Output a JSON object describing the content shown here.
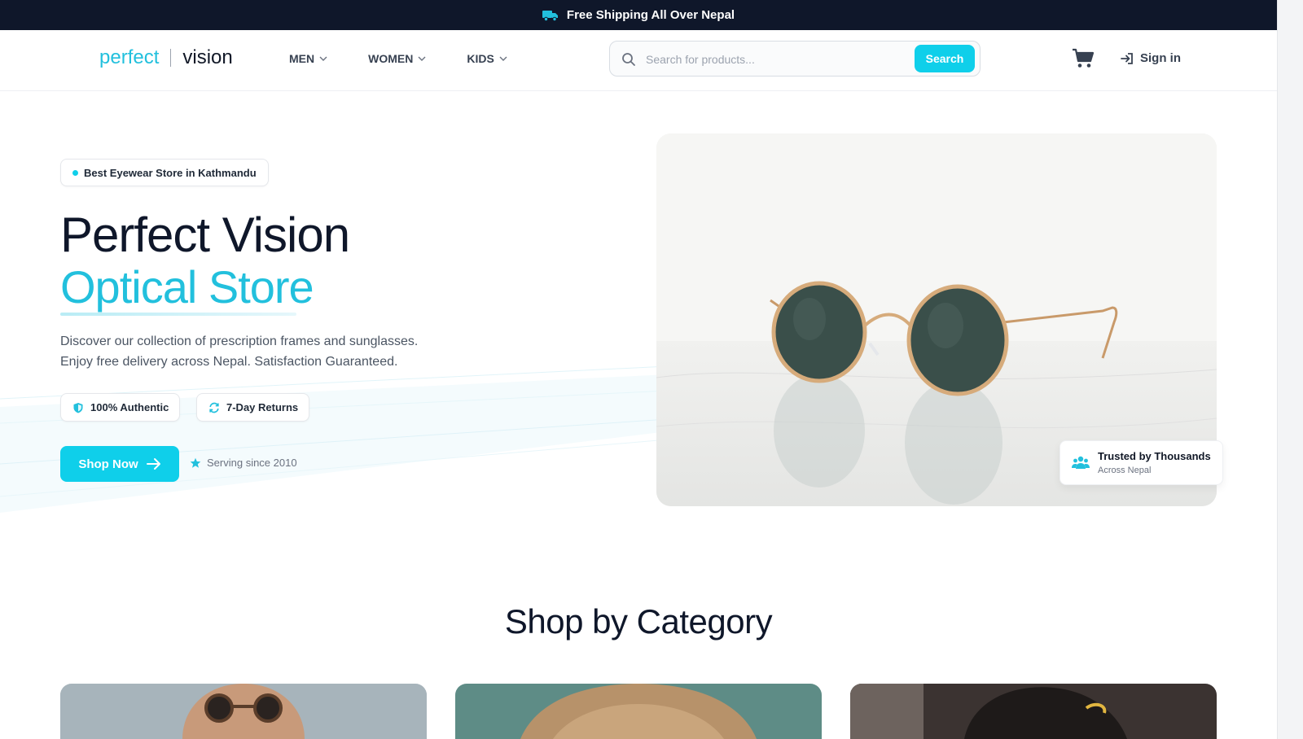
{
  "promo": {
    "text": "Free Shipping All Over Nepal",
    "icon": "truck-icon"
  },
  "header": {
    "logo_part1": "perfect",
    "logo_part2": "vision",
    "nav": [
      {
        "label": "MEN"
      },
      {
        "label": "WOMEN"
      },
      {
        "label": "KIDS"
      }
    ],
    "search": {
      "placeholder": "Search for products...",
      "value": "",
      "button_label": "Search"
    },
    "sign_in_label": "Sign in"
  },
  "hero": {
    "badge": "Best Eyewear Store in Kathmandu",
    "title_line1": "Perfect Vision",
    "title_line2": "Optical Store",
    "description_line1": "Discover our collection of prescription frames and sunglasses.",
    "description_line2": "Enjoy free delivery across Nepal. Satisfaction Guaranteed.",
    "pills": [
      {
        "label": "100% Authentic",
        "icon": "shield-icon"
      },
      {
        "label": "7-Day Returns",
        "icon": "refresh-icon"
      }
    ],
    "cta_label": "Shop Now",
    "since_label": "Serving since 2010",
    "trust": {
      "title": "Trusted by Thousands",
      "subtitle": "Across Nepal",
      "icon": "users-icon"
    }
  },
  "categories": {
    "title": "Shop by Category"
  },
  "colors": {
    "accent": "#0fcfea",
    "logo_accent": "#22c0dd",
    "promo_bg": "#0f172a",
    "heading": "#0f172a"
  }
}
